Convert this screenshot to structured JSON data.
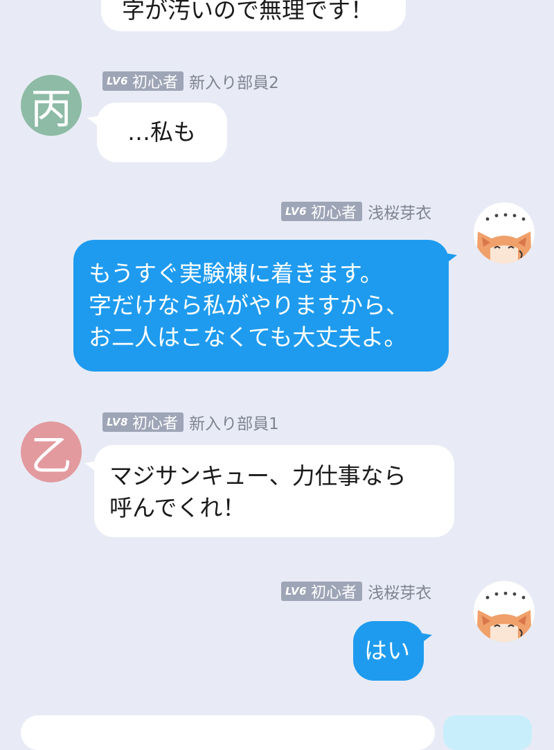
{
  "colors": {
    "background": "#e8ebf5",
    "own_bubble": "#1e9bef",
    "other_bubble": "#ffffff",
    "badge": "#9ea5b6",
    "avatar_hei": "#8dbba5",
    "avatar_otsu": "#e29a9f"
  },
  "messages": [
    {
      "text": "字が汚いので無理です！"
    },
    {
      "badge_level": "LV6",
      "badge_rank": "初心者",
      "sender": "新入り部員2",
      "avatar_glyph": "丙",
      "text": "…私も"
    },
    {
      "badge_level": "LV6",
      "badge_rank": "初心者",
      "sender": "浅桜芽衣",
      "avatar_icon": "cat-avatar-icon",
      "text": "もうすぐ実験棟に着きます。\n字だけなら私がやりますから、\nお二人はこなくても大丈夫よ。"
    },
    {
      "badge_level": "LV8",
      "badge_rank": "初心者",
      "sender": "新入り部員1",
      "avatar_glyph": "乙",
      "text": "マジサンキュー、力仕事なら\n呼んでくれ！"
    },
    {
      "badge_level": "LV6",
      "badge_rank": "初心者",
      "sender": "浅桜芽衣",
      "avatar_icon": "cat-avatar-icon",
      "text": "はい"
    }
  ]
}
